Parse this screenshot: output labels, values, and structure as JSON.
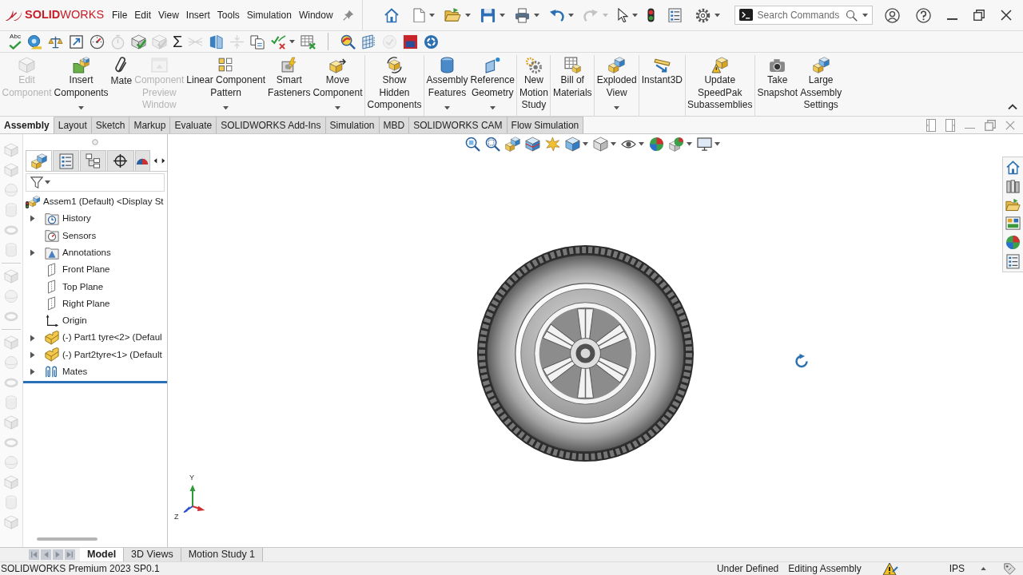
{
  "logo": {
    "text": "**SOLID**WORKS"
  },
  "menu": [
    "File",
    "Edit",
    "View",
    "Insert",
    "Tools",
    "Simulation",
    "Window"
  ],
  "quick_access": [
    {
      "has_menu": false,
      "disabled": false
    },
    {
      "has_menu": true,
      "disabled": false
    },
    {
      "has_menu": true,
      "disabled": false
    },
    {
      "has_menu": true,
      "disabled": false
    },
    {
      "has_menu": true,
      "disabled": false
    },
    {
      "has_menu": true,
      "disabled": false
    },
    {
      "has_menu": true,
      "disabled": true
    },
    {
      "has_menu": true,
      "disabled": false
    },
    {
      "has_menu": false,
      "disabled": false
    },
    {
      "has_menu": false,
      "disabled": false
    },
    {
      "has_menu": true,
      "disabled": false
    }
  ],
  "search": {
    "placeholder": "Search Commands"
  },
  "command_bar": [
    [
      {
        "glyph": "Abc",
        "disabled": false,
        "has_menu": false
      },
      {
        "disabled": false,
        "has_menu": false
      },
      {
        "disabled": false,
        "has_menu": false
      },
      {
        "disabled": false,
        "has_menu": false
      },
      {
        "disabled": false,
        "has_menu": false
      },
      {
        "disabled": true,
        "has_menu": false
      },
      {
        "disabled": false,
        "has_menu": false
      },
      {
        "disabled": true,
        "has_menu": false
      },
      {
        "glyph": "Σ",
        "disabled": false,
        "has_menu": false
      },
      {
        "disabled": true,
        "has_menu": false
      },
      {
        "disabled": false,
        "has_menu": false
      },
      {
        "disabled": true,
        "has_menu": false
      },
      {
        "disabled": false,
        "has_menu": false
      },
      {
        "disabled": false,
        "has_menu": true
      },
      {
        "disabled": false,
        "has_menu": false
      }
    ],
    [
      {
        "disabled": false,
        "has_menu": false
      },
      {
        "disabled": false,
        "has_menu": false
      },
      {
        "disabled": true,
        "has_menu": false
      },
      {
        "disabled": false,
        "has_menu": false
      },
      {
        "disabled": false,
        "has_menu": false
      }
    ]
  ],
  "ribbon": [
    [
      {
        "label": [
          "Edit",
          "Component"
        ],
        "disabled": true,
        "has_menu": false
      },
      {
        "label": [
          "Insert",
          "Components"
        ],
        "disabled": false,
        "has_menu": true
      },
      {
        "label": [
          "Mate"
        ],
        "disabled": false,
        "has_menu": false
      },
      {
        "label": [
          "Component",
          "Preview",
          "Window"
        ],
        "disabled": true,
        "has_menu": false
      },
      {
        "label": [
          "Linear Component",
          "Pattern"
        ],
        "disabled": false,
        "has_menu": true
      },
      {
        "label": [
          "Smart",
          "Fasteners"
        ],
        "disabled": false,
        "has_menu": false
      },
      {
        "label": [
          "Move",
          "Component"
        ],
        "disabled": false,
        "has_menu": true
      }
    ],
    [
      {
        "label": [
          "Show",
          "Hidden",
          "Components"
        ],
        "disabled": false,
        "has_menu": false
      }
    ],
    [
      {
        "label": [
          "Assembly",
          "Features"
        ],
        "disabled": false,
        "has_menu": true
      },
      {
        "label": [
          "Reference",
          "Geometry"
        ],
        "disabled": false,
        "has_menu": true
      }
    ],
    [
      {
        "label": [
          "New",
          "Motion",
          "Study"
        ],
        "disabled": false,
        "has_menu": false
      }
    ],
    [
      {
        "label": [
          "Bill of",
          "Materials"
        ],
        "disabled": false,
        "has_menu": false
      }
    ],
    [
      {
        "label": [
          "Exploded",
          "View"
        ],
        "disabled": false,
        "has_menu": true
      }
    ],
    [
      {
        "label": [
          "Instant3D"
        ],
        "disabled": false,
        "has_menu": false
      }
    ],
    [
      {
        "label": [
          "Update",
          "SpeedPak",
          "Subassemblies"
        ],
        "disabled": false,
        "has_menu": false
      }
    ],
    [
      {
        "label": [
          "Take",
          "Snapshot"
        ],
        "disabled": false,
        "has_menu": false
      },
      {
        "label": [
          "Large",
          "Assembly",
          "Settings"
        ],
        "disabled": false,
        "has_menu": false
      }
    ]
  ],
  "tabs": [
    {
      "label": "Assembly",
      "selected": true
    },
    {
      "label": "Layout",
      "selected": false
    },
    {
      "label": "Sketch",
      "selected": false
    },
    {
      "label": "Markup",
      "selected": false
    },
    {
      "label": "Evaluate",
      "selected": false
    },
    {
      "label": "SOLIDWORKS Add-Ins",
      "selected": false
    },
    {
      "label": "Simulation",
      "selected": false
    },
    {
      "label": "MBD",
      "selected": false
    },
    {
      "label": "SOLIDWORKS CAM",
      "selected": false
    },
    {
      "label": "Flow Simulation",
      "selected": false
    }
  ],
  "side_toolbar": [
    [
      {
        "disabled": true
      },
      {
        "disabled": true
      },
      {
        "disabled": true
      },
      {
        "disabled": true
      },
      {
        "disabled": true
      },
      {
        "disabled": true
      }
    ],
    [
      {
        "disabled": true
      },
      {
        "disabled": true
      },
      {
        "disabled": true
      }
    ],
    [
      {
        "disabled": true
      },
      {
        "disabled": true
      },
      {
        "disabled": true
      },
      {
        "disabled": true
      },
      {
        "disabled": true
      },
      {
        "disabled": true
      },
      {
        "disabled": true
      },
      {
        "disabled": true
      },
      {
        "disabled": true
      },
      {
        "disabled": true
      }
    ]
  ],
  "panel_tabs": [
    {
      "selected": true
    },
    {
      "selected": false
    },
    {
      "selected": false
    },
    {
      "selected": false
    },
    {
      "selected": false
    }
  ],
  "tree": {
    "label": "Assem1 (Default) <Display St",
    "kind": "assembly",
    "children": [
      {
        "label": "History",
        "kind": "history",
        "expandable": true
      },
      {
        "label": "Sensors",
        "kind": "sensors",
        "expandable": false
      },
      {
        "label": "Annotations",
        "kind": "annotations",
        "expandable": true
      },
      {
        "label": "Front Plane",
        "kind": "plane",
        "expandable": false
      },
      {
        "label": "Top Plane",
        "kind": "plane",
        "expandable": false
      },
      {
        "label": "Right Plane",
        "kind": "plane",
        "expandable": false
      },
      {
        "label": "Origin",
        "kind": "origin",
        "expandable": false
      },
      {
        "label": "(-) Part1 tyre<2> (Defaul",
        "kind": "part",
        "expandable": true
      },
      {
        "label": "(-) Part2tyre<1> (Default",
        "kind": "part",
        "expandable": true
      },
      {
        "label": "Mates",
        "kind": "mates",
        "expandable": true
      }
    ]
  },
  "view_toolbar": [
    {
      "has_menu": false
    },
    {
      "has_menu": false
    },
    {
      "has_menu": false
    },
    {
      "has_menu": false
    },
    {
      "has_menu": false
    },
    {
      "has_menu": true
    },
    {
      "has_menu": true
    },
    {
      "has_menu": true
    },
    {
      "has_menu": false
    },
    {
      "has_menu": true
    },
    {
      "has_menu": true
    }
  ],
  "triad": {
    "labels": [
      "Y",
      "Z"
    ]
  },
  "bottom_tabs": [
    {
      "label": "Model",
      "selected": true
    },
    {
      "label": "3D Views",
      "selected": false
    },
    {
      "label": "Motion Study 1",
      "selected": false
    }
  ],
  "status_bar": {
    "product": "SOLIDWORKS Premium 2023 SP0.1",
    "state": "Under Defined",
    "mode": "Editing Assembly",
    "units": "IPS"
  }
}
